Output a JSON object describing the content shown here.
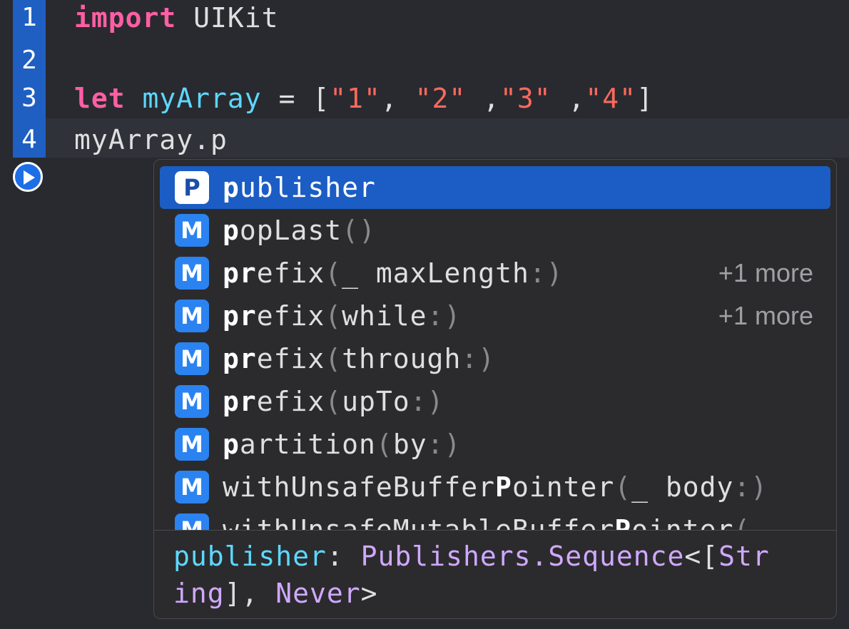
{
  "editor": {
    "lines": [
      {
        "number": "1",
        "tokens": [
          {
            "text": "import",
            "kind": "kw"
          },
          {
            "text": " UIKit",
            "kind": "plain"
          }
        ]
      },
      {
        "number": "2",
        "tokens": []
      },
      {
        "number": "3",
        "tokens": [
          {
            "text": "let",
            "kind": "kw"
          },
          {
            "text": " ",
            "kind": "plain"
          },
          {
            "text": "myArray",
            "kind": "ident"
          },
          {
            "text": " = [",
            "kind": "plain"
          },
          {
            "text": "\"1\"",
            "kind": "str"
          },
          {
            "text": ", ",
            "kind": "plain"
          },
          {
            "text": "\"2\"",
            "kind": "str"
          },
          {
            "text": " ,",
            "kind": "plain"
          },
          {
            "text": "\"3\"",
            "kind": "str"
          },
          {
            "text": " ,",
            "kind": "plain"
          },
          {
            "text": "\"4\"",
            "kind": "str"
          },
          {
            "text": "]",
            "kind": "plain"
          }
        ]
      },
      {
        "number": "4",
        "tokens": [
          {
            "text": "myArray.p",
            "kind": "plain"
          }
        ]
      }
    ],
    "colors": {
      "keyword": "#fc5fa3",
      "identifier": "#5dd8ff",
      "string": "#fc6a5d",
      "gutter": "#1f5fc2"
    },
    "run_icon": "play-circle-icon"
  },
  "completions": {
    "items": [
      {
        "badge": "P",
        "bold": "p",
        "rest": "ublisher",
        "params": "",
        "more": ""
      },
      {
        "badge": "M",
        "bold": "p",
        "rest": "opLast",
        "params": "()",
        "more": ""
      },
      {
        "badge": "M",
        "bold": "pr",
        "rest": "efix",
        "params": "(_ maxLength:)",
        "more": "+1 more"
      },
      {
        "badge": "M",
        "bold": "pr",
        "rest": "efix",
        "params": "(while:)",
        "more": "+1 more"
      },
      {
        "badge": "M",
        "bold": "pr",
        "rest": "efix",
        "params": "(through:)",
        "more": ""
      },
      {
        "badge": "M",
        "bold": "pr",
        "rest": "efix",
        "params": "(upTo:)",
        "more": ""
      },
      {
        "badge": "M",
        "bold": "p",
        "rest": "artition",
        "params": "(by:)",
        "more": ""
      },
      {
        "badge": "M",
        "bold": "",
        "rest": "withUnsafeBuffer|P|ointer",
        "params": "(_ body:)",
        "more": ""
      },
      {
        "badge": "M",
        "bold": "",
        "rest": "withUnsafeMutableBuffer|P|ointer",
        "params": "(",
        "more": ""
      }
    ],
    "selected_index": 0,
    "detail": {
      "name": "publisher",
      "separator": ": ",
      "type_part1": "Publishers.Sequence",
      "punct1": "<[",
      "type_part2": "Str\ning",
      "punct2": "], ",
      "type_part3": "Never",
      "punct3": ">"
    }
  }
}
